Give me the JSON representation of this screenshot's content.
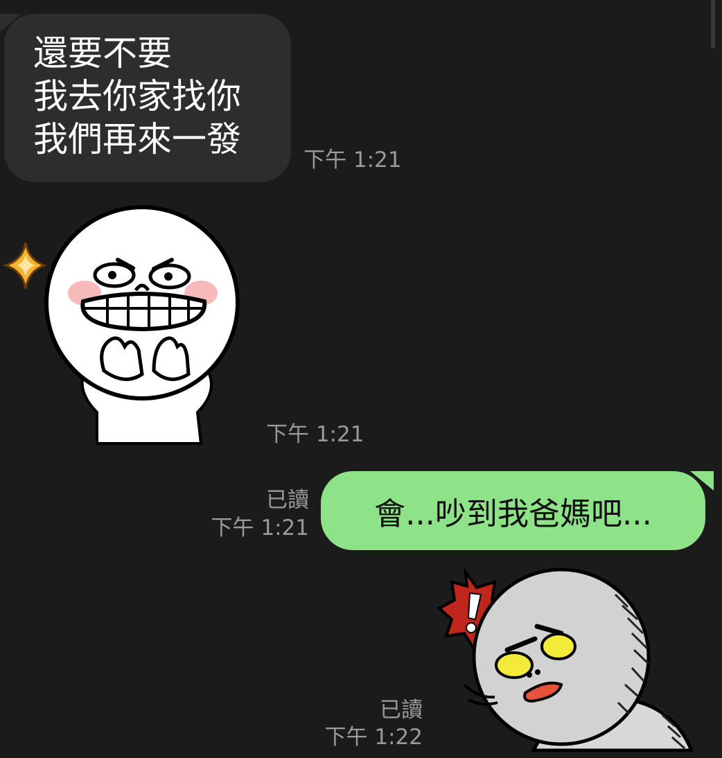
{
  "colors": {
    "background": "#1b1b1b",
    "incoming_bubble": "#2d2d2d",
    "outgoing_bubble": "#8ee287",
    "meta_text": "#9a9a9a"
  },
  "messages": [
    {
      "direction": "incoming",
      "type": "text",
      "lines": [
        "還要不要",
        "我去你家找你",
        "我們再來一發"
      ],
      "time": "下午 1:21"
    },
    {
      "direction": "incoming",
      "type": "sticker",
      "sticker": "grinning-moon-character-sticker",
      "time": "下午 1:21"
    },
    {
      "direction": "outgoing",
      "type": "text",
      "text": "會...吵到我爸媽吧...",
      "read": "已讀",
      "time": "下午 1:21"
    },
    {
      "direction": "outgoing",
      "type": "sticker",
      "sticker": "annoyed-moon-exclamation-sticker",
      "read": "已讀",
      "time": "下午 1:22"
    }
  ]
}
